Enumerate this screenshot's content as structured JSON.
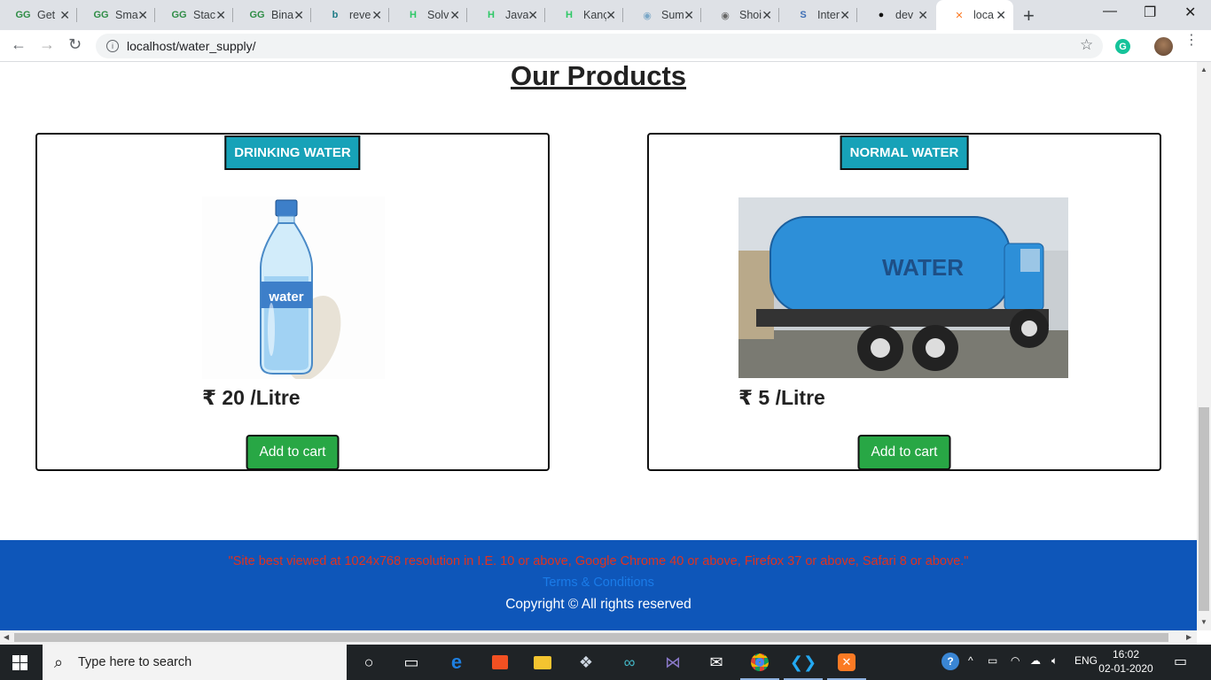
{
  "tabs": [
    {
      "title": "Get",
      "favicon": "gfg-icon",
      "fav_text": "GG",
      "fav_color": "#2f8d46"
    },
    {
      "title": "Sma",
      "favicon": "gfg-icon",
      "fav_text": "GG",
      "fav_color": "#2f8d46"
    },
    {
      "title": "Stac",
      "favicon": "gfg-icon",
      "fav_text": "GG",
      "fav_color": "#2f8d46"
    },
    {
      "title": "Bina",
      "favicon": "gfg-icon",
      "fav_text": "GG",
      "fav_color": "#2f8d46"
    },
    {
      "title": "reve",
      "favicon": "bing-icon",
      "fav_text": "b",
      "fav_color": "#1b7a86"
    },
    {
      "title": "Solv",
      "favicon": "hackerrank-icon",
      "fav_text": "H",
      "fav_color": "#2ec866"
    },
    {
      "title": "Java",
      "favicon": "hackerrank-icon",
      "fav_text": "H",
      "fav_color": "#2ec866"
    },
    {
      "title": "Kanç",
      "favicon": "hackerrank-icon",
      "fav_text": "H",
      "fav_color": "#2ec866"
    },
    {
      "title": "Sum",
      "favicon": "globe-icon",
      "fav_text": "◉",
      "fav_color": "#7aa7c7"
    },
    {
      "title": "Shoi",
      "favicon": "globe-icon",
      "fav_text": "◉",
      "fav_color": "#666666"
    },
    {
      "title": "Inter",
      "favicon": "s-icon",
      "fav_text": "S",
      "fav_color": "#3d6eb5"
    },
    {
      "title": "dev",
      "favicon": "github-icon",
      "fav_text": "●",
      "fav_color": "#111111"
    },
    {
      "title": "loca",
      "favicon": "xampp-icon",
      "fav_text": "✕",
      "fav_color": "#fb7a24"
    }
  ],
  "tab_close_glyph": "✕",
  "new_tab_glyph": "+",
  "window_controls": {
    "minimize": "—",
    "restore": "❐",
    "close": "✕"
  },
  "toolbar": {
    "back": "←",
    "forward": "→",
    "reload": "↻",
    "url": "localhost/water_supply/",
    "info_glyph": "i",
    "star": "☆",
    "grammarly": "G",
    "menu": "⋮"
  },
  "page": {
    "title": "Our Products",
    "products": [
      {
        "tag": "DRINKING WATER",
        "price": "₹ 20 /Litre",
        "button": "Add to cart",
        "image": "water-bottle"
      },
      {
        "tag": "NORMAL WATER",
        "price": "₹ 5 /Litre",
        "button": "Add to cart",
        "image": "water-tanker-truck",
        "truck_text": "WATER"
      }
    ],
    "bottle_label": "water"
  },
  "footer": {
    "note": "\"Site best viewed at 1024x768 resolution in I.E. 10 or above, Google Chrome 40 or above, Firefox 37 or above, Safari 8 or above.\"",
    "terms": "Terms & Conditions",
    "copyright": "Copyright © All rights reserved"
  },
  "taskbar": {
    "search_placeholder": "Type here to search",
    "lang": "ENG",
    "time": "16:02",
    "date": "02-01-2020"
  }
}
